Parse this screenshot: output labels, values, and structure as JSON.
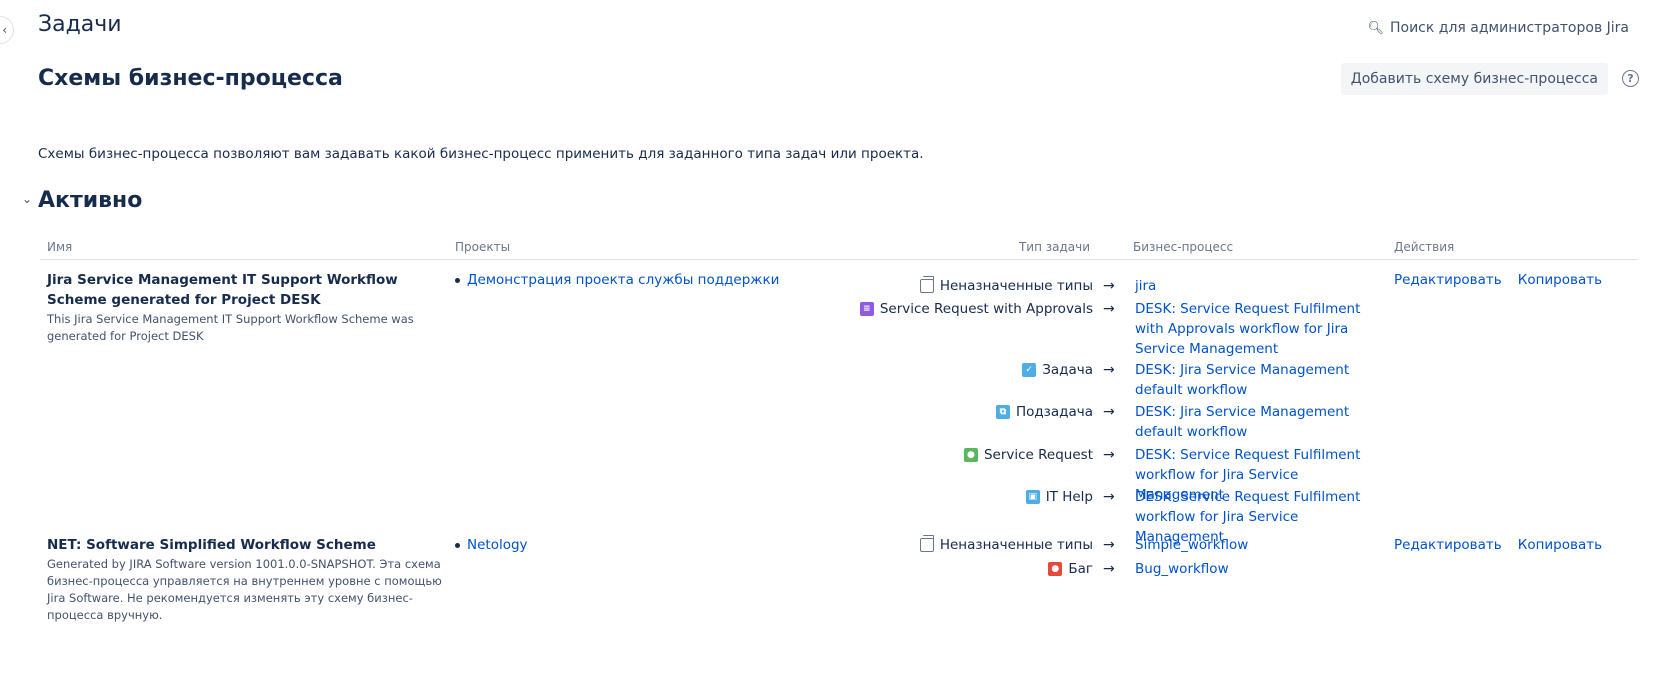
{
  "header": {
    "title": "Задачи",
    "admin_search": "Поиск для администраторов Jira"
  },
  "page": {
    "title": "Схемы бизнес-процесса",
    "add_button": "Добавить схему бизнес-процесса",
    "description": "Схемы бизнес-процесса позволяют вам задавать какой бизнес-процесс применить для заданного типа задач или проекта."
  },
  "section": {
    "title": "Активно"
  },
  "table": {
    "headers": {
      "name": "Имя",
      "projects": "Проекты",
      "issue_type": "Тип задачи",
      "workflow": "Бизнес-процесс",
      "actions": "Действия"
    },
    "rows": [
      {
        "name": "Jira Service Management IT Support Workflow Scheme generated for Project DESK",
        "description": "This Jira Service Management IT Support Workflow Scheme was generated for Project DESK",
        "project": "Демонстрация проекта службы поддержки",
        "mappings": [
          {
            "type": "Неназначенные типы",
            "icon": "unassigned-types-icon",
            "workflow": "jira"
          },
          {
            "type": "Service Request with Approvals",
            "icon": "service-request-approvals-icon",
            "workflow": "DESK: Service Request Fulfilment with Approvals workflow for Jira Service Management"
          },
          {
            "type": "Задача",
            "icon": "task-icon",
            "workflow": "DESK: Jira Service Management default workflow"
          },
          {
            "type": "Подзадача",
            "icon": "subtask-icon",
            "workflow": "DESK: Jira Service Management default workflow"
          },
          {
            "type": "Service Request",
            "icon": "service-request-icon",
            "workflow": "DESK: Service Request Fulfilment workflow for Jira Service Management"
          },
          {
            "type": "IT Help",
            "icon": "it-help-icon",
            "workflow": "DESK: Service Request Fulfilment workflow for Jira Service Management"
          }
        ],
        "actions": {
          "edit": "Редактировать",
          "copy": "Копировать"
        }
      },
      {
        "name": "NET: Software Simplified Workflow Scheme",
        "description": "Generated by JIRA Software version 1001.0.0-SNAPSHOT. Эта схема бизнес-процесса управляется на внутреннем уровне с помощью Jira Software. Не рекомендуется изменять эту схему бизнес-процесса вручную.",
        "project": "Netology",
        "mappings": [
          {
            "type": "Неназначенные типы",
            "icon": "unassigned-types-icon",
            "workflow": "Simple_workflow"
          },
          {
            "type": "Баг",
            "icon": "bug-icon",
            "workflow": "Bug_workflow"
          }
        ],
        "actions": {
          "edit": "Редактировать",
          "copy": "Копировать"
        }
      }
    ]
  },
  "arrow": "→",
  "colors": {
    "link": "#0052cc",
    "text": "#172b4d",
    "muted": "#6b778c",
    "approvals": "#8f5be0",
    "task": "#4fade6",
    "service_request": "#5ab85c",
    "bug": "#e5493a"
  }
}
